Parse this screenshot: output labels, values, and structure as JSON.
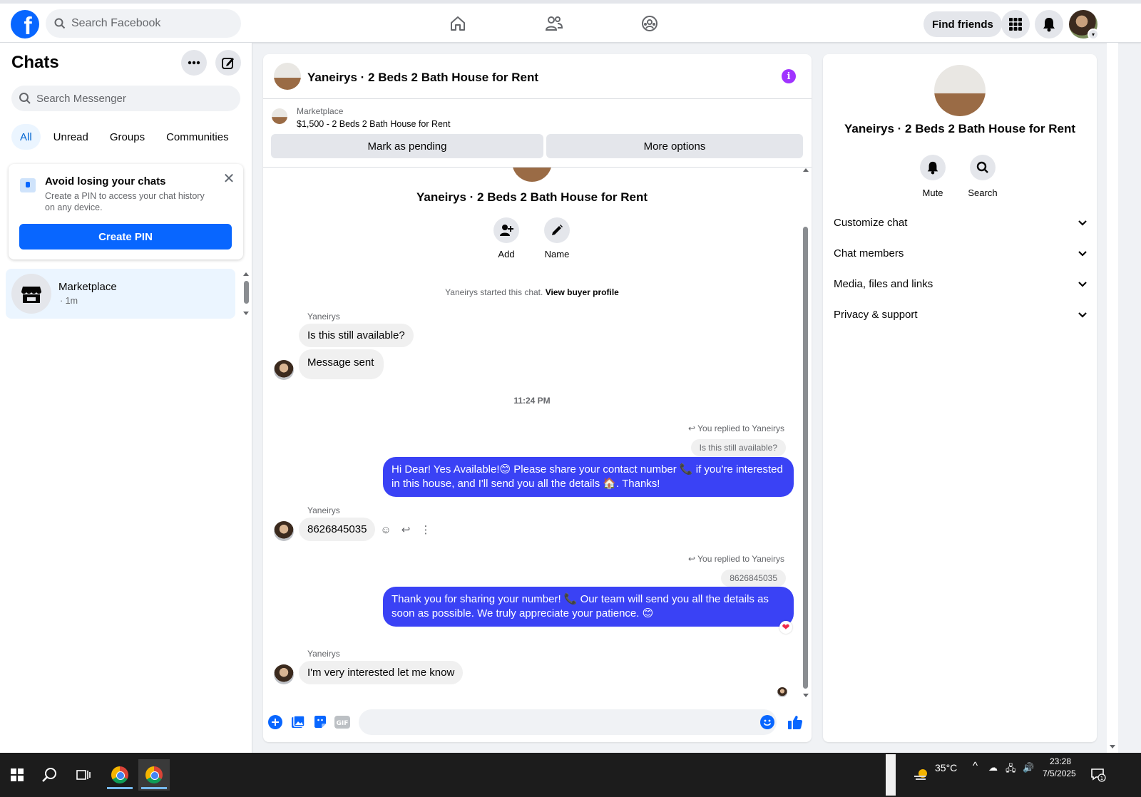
{
  "topbar": {
    "logo": "f",
    "search_placeholder": "Search Facebook",
    "find_friends": "Find friends",
    "nav": [
      "home-icon",
      "friends-icon",
      "groups-icon"
    ],
    "right_icons": [
      "menu-grid-icon",
      "bell-icon",
      "avatar"
    ]
  },
  "left": {
    "title": "Chats",
    "search_placeholder": "Search Messenger",
    "filters": [
      "All",
      "Unread",
      "Groups",
      "Communities"
    ],
    "active_filter": "All",
    "pin_card": {
      "title": "Avoid losing your chats",
      "desc": "Create a PIN to access your chat history on any device.",
      "button": "Create PIN"
    },
    "conversation": {
      "name": "Marketplace",
      "time": "· 1m"
    }
  },
  "chat": {
    "title": "Yaneirys · 2 Beds 2 Bath House for Rent",
    "listing_label": "Marketplace",
    "listing_title": "$1,500 - 2 Beds 2 Bath House for Rent",
    "mark_pending": "Mark as pending",
    "more_options": "More options",
    "intro_title": "Yaneirys · 2 Beds 2 Bath House for Rent",
    "intro_actions": [
      "Add",
      "Name"
    ],
    "started_prefix": "Yaneirys started this chat.",
    "started_link": "View buyer profile",
    "messages": {
      "sender1": "Yaneirys",
      "in1": "Is this still available?",
      "in2": "Message sent",
      "timestamp": "11:24 PM",
      "replied1": "You replied to Yaneirys",
      "quoted1": "Is this still available?",
      "out1": "Hi Dear! Yes Available!😊 Please share your contact number 📞 if you're interested in this house, and I'll send you all the details 🏠. Thanks!",
      "sender2": "Yaneirys",
      "in3": "8626845035",
      "replied2": "You replied to Yaneirys",
      "quoted2": "8626845035",
      "out2": "Thank you for sharing your number! 📞 Our team will send you all the details as soon as possible. We truly appreciate your patience. 😊",
      "sender3": "Yaneirys",
      "in4": "I'm very interested let me know"
    },
    "composer_placeholder": ""
  },
  "right": {
    "title": "Yaneirys · 2 Beds 2 Bath House for Rent",
    "actions": [
      "Mute",
      "Search"
    ],
    "sections": [
      "Customize chat",
      "Chat members",
      "Media, files and links",
      "Privacy & support"
    ]
  },
  "taskbar": {
    "weather": "35°C",
    "time": "23:28",
    "date": "7/5/2025",
    "notifications": "1"
  },
  "colors": {
    "brand": "#0866ff",
    "outgoing_bubble": "#3a42f5",
    "info": "#a033ff"
  }
}
